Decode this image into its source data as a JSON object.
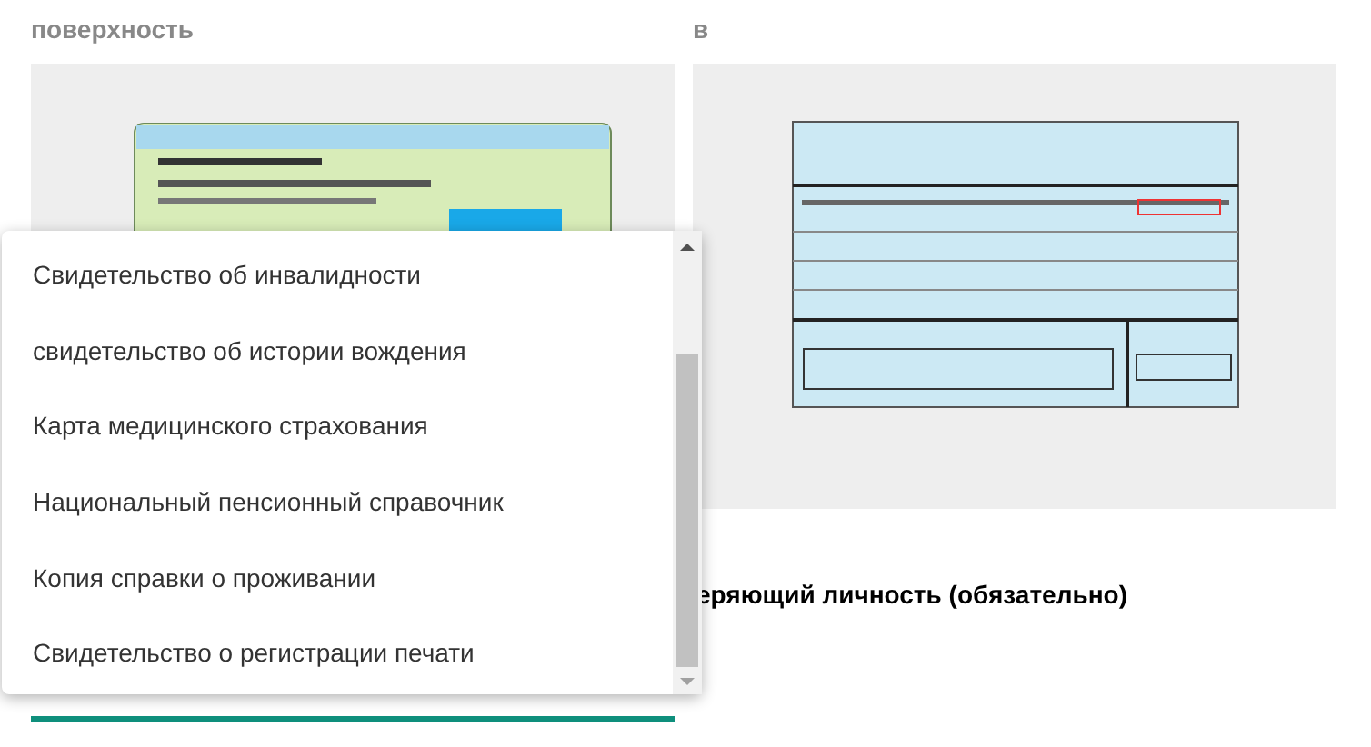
{
  "panels": [
    {
      "label": "поверхность"
    },
    {
      "label": "в"
    }
  ],
  "section_heading": "еряющий личность (обязательно)",
  "dropdown": {
    "items": [
      {
        "label": "Свидетельство об инвалидности",
        "selected": false
      },
      {
        "label": "свидетельство об истории вождения",
        "selected": false
      },
      {
        "label": "Карта медицинского страхования",
        "selected": false
      },
      {
        "label": "Национальный пенсионный справочник",
        "selected": false
      },
      {
        "label": "Копия справки о проживании",
        "selected": false
      },
      {
        "label": "Свидетельство о регистрации печати",
        "selected": false
      }
    ]
  }
}
